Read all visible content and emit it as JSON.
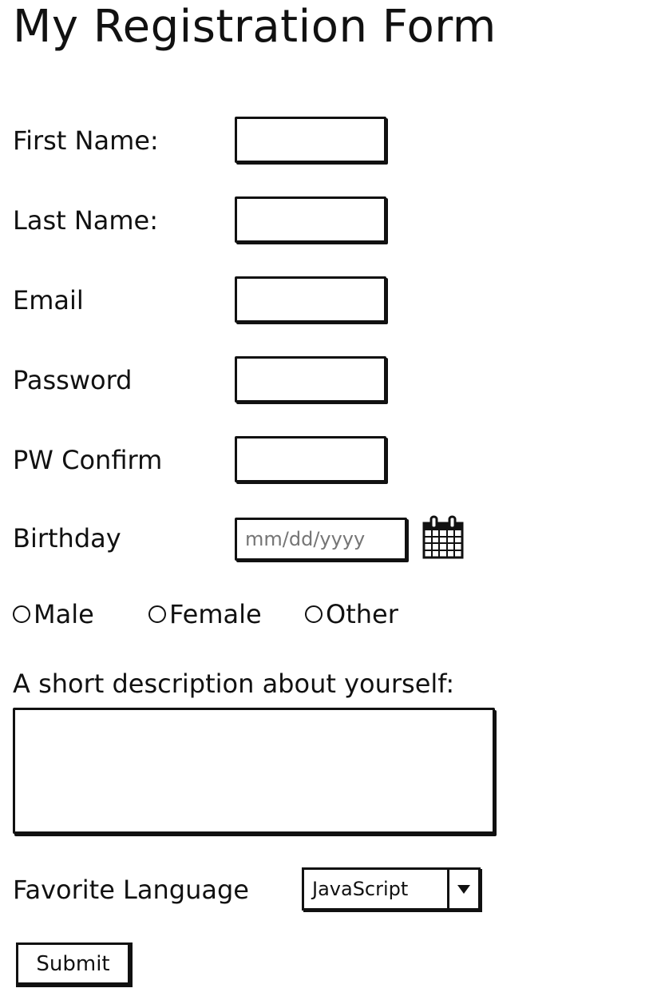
{
  "form": {
    "title": "My Registration Form",
    "fields": {
      "first_name_label": "First Name:",
      "last_name_label": "Last Name:",
      "email_label": "Email",
      "password_label": "Password",
      "pw_confirm_label": "PW Confirm",
      "birthday_label": "Birthday",
      "birthday_placeholder": "mm/dd/yyyy"
    },
    "gender": {
      "options": [
        "Male",
        "Female",
        "Other"
      ]
    },
    "description_label": "A short description about yourself:",
    "language": {
      "label": "Favorite Language",
      "selected": "JavaScript"
    },
    "submit_label": "Submit"
  },
  "icons": {
    "calendar": "calendar-icon",
    "dropdown": "triangle-down-icon"
  },
  "colors": {
    "ink": "#111111",
    "background": "#ffffff"
  }
}
